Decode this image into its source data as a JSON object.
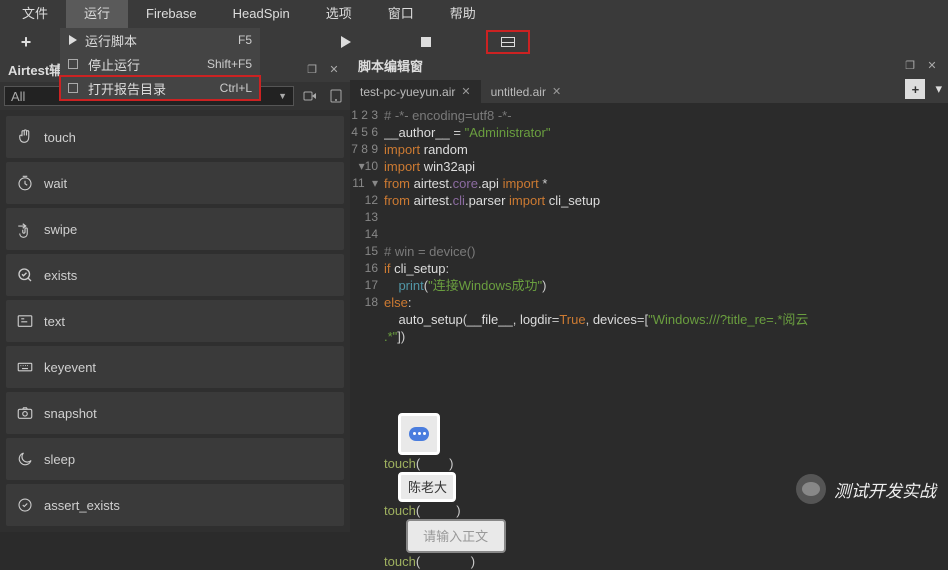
{
  "menubar": {
    "items": [
      "文件",
      "运行",
      "Firebase",
      "HeadSpin",
      "选项",
      "窗口",
      "帮助"
    ],
    "active_index": 1
  },
  "dropdown": {
    "items": [
      {
        "label": "运行脚本",
        "shortcut": "F5",
        "icon": "play"
      },
      {
        "label": "停止运行",
        "shortcut": "Shift+F5",
        "icon": "stop"
      },
      {
        "label": "打开报告目录",
        "shortcut": "Ctrl+L",
        "icon": "square",
        "highlight": true
      }
    ]
  },
  "left": {
    "header_title": "Airtest辅",
    "filter_label": "All",
    "commands": [
      {
        "name": "touch",
        "icon": "hand"
      },
      {
        "name": "wait",
        "icon": "clock"
      },
      {
        "name": "swipe",
        "icon": "swipe"
      },
      {
        "name": "exists",
        "icon": "check"
      },
      {
        "name": "text",
        "icon": "text"
      },
      {
        "name": "keyevent",
        "icon": "keyboard"
      },
      {
        "name": "snapshot",
        "icon": "camera"
      },
      {
        "name": "sleep",
        "icon": "moon"
      },
      {
        "name": "assert_exists",
        "icon": "assert"
      }
    ]
  },
  "right": {
    "header_title": "脚本编辑窗",
    "tabs": [
      {
        "label": "test-pc-yueyun.air",
        "active": true
      },
      {
        "label": "untitled.air",
        "active": false
      }
    ]
  },
  "code": {
    "lines": [
      {
        "n": "1",
        "html": "<span class='c-comment'># -*- encoding=utf8 -*-</span>"
      },
      {
        "n": "2",
        "html": "<span class='c-id'>__author__</span> <span class='c-op'>=</span> <span class='c-str'>\"Administrator\"</span>"
      },
      {
        "n": "3",
        "html": "<span class='c-kw'>import</span> <span class='c-id'>random</span>"
      },
      {
        "n": "4",
        "html": "<span class='c-kw'>import</span> <span class='c-id'>win32api</span>"
      },
      {
        "n": "5",
        "html": "<span class='c-kw'>from</span> <span class='c-id'>airtest</span><span class='c-op'>.</span><span class='c-mod'>core</span><span class='c-op'>.</span><span class='c-id'>api</span> <span class='c-kw'>import</span> <span class='c-op'>*</span>"
      },
      {
        "n": "6",
        "html": "<span class='c-kw'>from</span> <span class='c-id'>airtest</span><span class='c-op'>.</span><span class='c-mod'>cli</span><span class='c-op'>.</span><span class='c-id'>parser</span> <span class='c-kw'>import</span> <span class='c-id'>cli_setup</span>"
      },
      {
        "n": "7",
        "html": ""
      },
      {
        "n": "8",
        "html": ""
      },
      {
        "n": "9",
        "html": "<span class='c-comment'># win = device()</span>"
      },
      {
        "n": "10",
        "fold": "v",
        "html": "<span class='c-kw'>if</span> <span class='c-id'>cli_setup</span><span class='c-op'>:</span>"
      },
      {
        "n": "11",
        "html": "    <span class='c-builtin'>print</span><span class='c-op'>(</span><span class='c-str'>\"连接Windows成功\"</span><span class='c-op'>)</span>"
      },
      {
        "n": "12",
        "fold": "v",
        "html": "<span class='c-kw'>else</span><span class='c-op'>:</span>"
      },
      {
        "n": "13",
        "html": "    <span class='c-id'>auto_setup</span><span class='c-op'>(</span><span class='c-id'>__file__</span><span class='c-op'>,</span> <span class='c-id'>logdir</span><span class='c-op'>=</span><span class='c-bool'>True</span><span class='c-op'>,</span> <span class='c-id'>devices</span><span class='c-op'>=[</span><span class='c-str'>\"Windows:///?title_re=.*阅云</span>"
      },
      {
        "n": "",
        "html": "<span class='c-str'>.*\"</span><span class='c-op'>])</span>"
      },
      {
        "n": "14",
        "html": ""
      },
      {
        "n": "15",
        "html": ""
      },
      {
        "n": "16",
        "html": ""
      }
    ],
    "touch_label": "touch",
    "img2_text": "陈老大",
    "img3_text": "请输入正文",
    "trail_lines": [
      "17",
      "",
      "18",
      ""
    ]
  },
  "watermark": "测试开发实战"
}
